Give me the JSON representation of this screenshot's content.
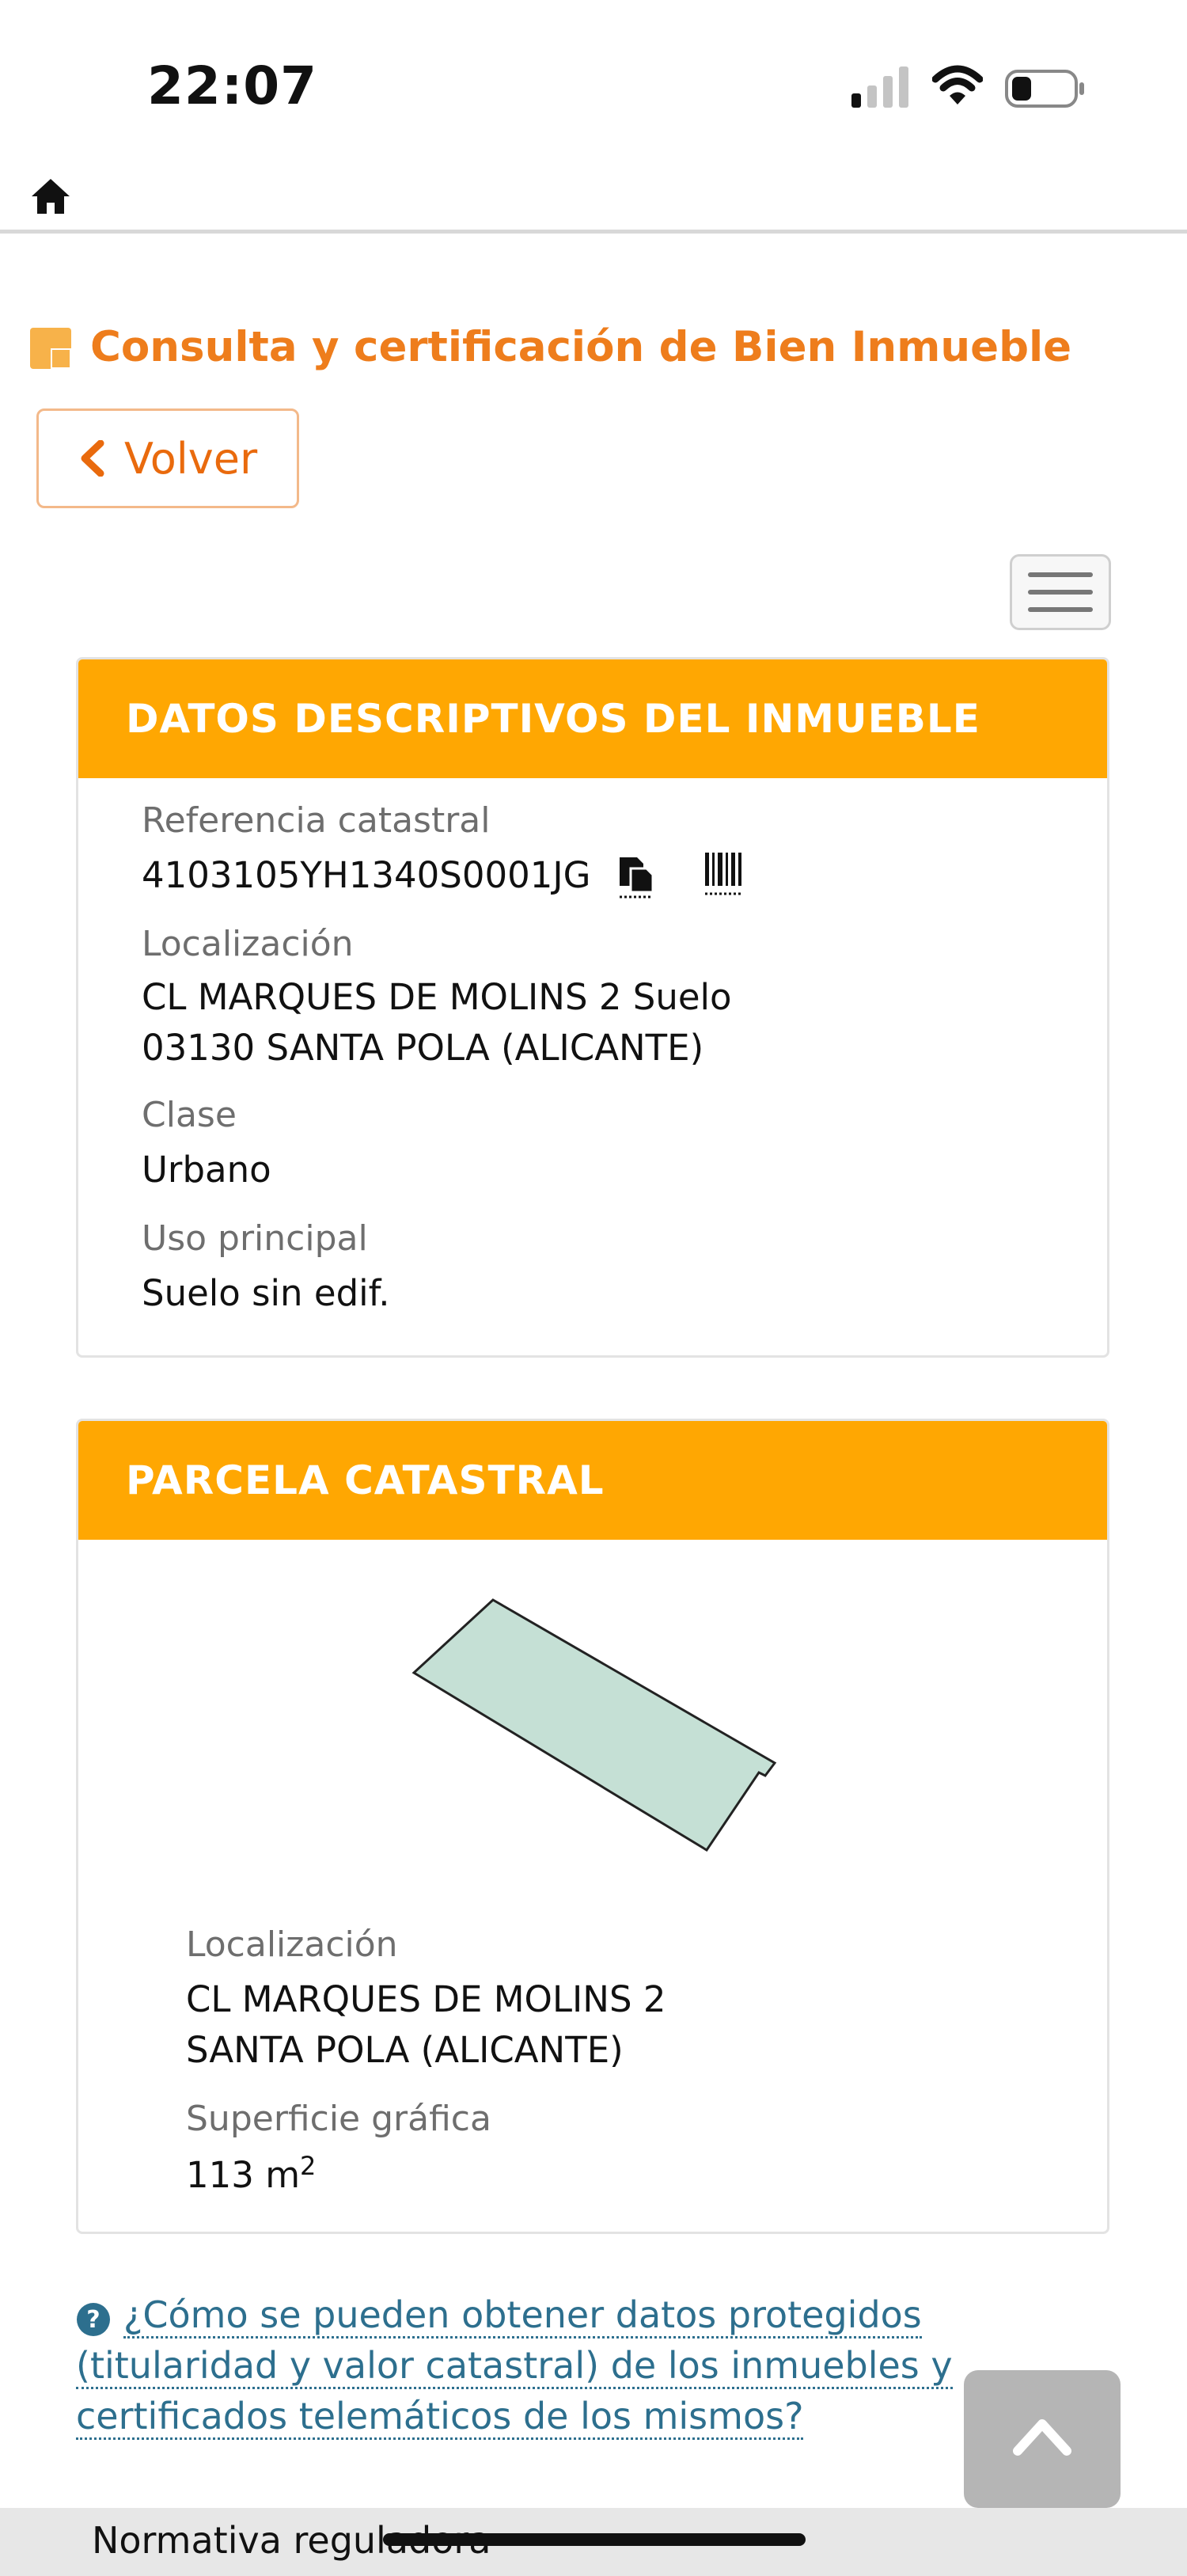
{
  "status_bar": {
    "time": "22:07"
  },
  "header": {
    "title": "Consulta y certificación de Bien Inmueble",
    "back_label": "Volver"
  },
  "descriptive_card": {
    "heading": "DATOS DESCRIPTIVOS DEL INMUEBLE",
    "ref_label": "Referencia catastral",
    "ref_value": "4103105YH1340S0001JG",
    "location_label": "Localización",
    "location_line1": "CL MARQUES DE MOLINS 2 Suelo",
    "location_line2": "03130 SANTA POLA (ALICANTE)",
    "class_label": "Clase",
    "class_value": "Urbano",
    "use_label": "Uso principal",
    "use_value": "Suelo sin edif."
  },
  "parcel_card": {
    "heading": "PARCELA CATASTRAL",
    "location_label": "Localización",
    "location_line1": "CL MARQUES DE MOLINS 2",
    "location_line2": "SANTA POLA (ALICANTE)",
    "surface_label": "Superficie gráfica",
    "surface_value": "113 m",
    "surface_unit_sup": "2",
    "parcel_fill_color": "#c5e0d5"
  },
  "help": {
    "text": "¿Cómo se pueden obtener datos protegidos (titularidad y valor catastral) de los inmuebles y certificados telemáticos de los mismos?"
  },
  "footer": {
    "text": "Normativa reguladora"
  },
  "colors": {
    "accent_orange": "#ffa702",
    "title_orange": "#ee7d1c",
    "link_blue": "#2d6f8e"
  }
}
